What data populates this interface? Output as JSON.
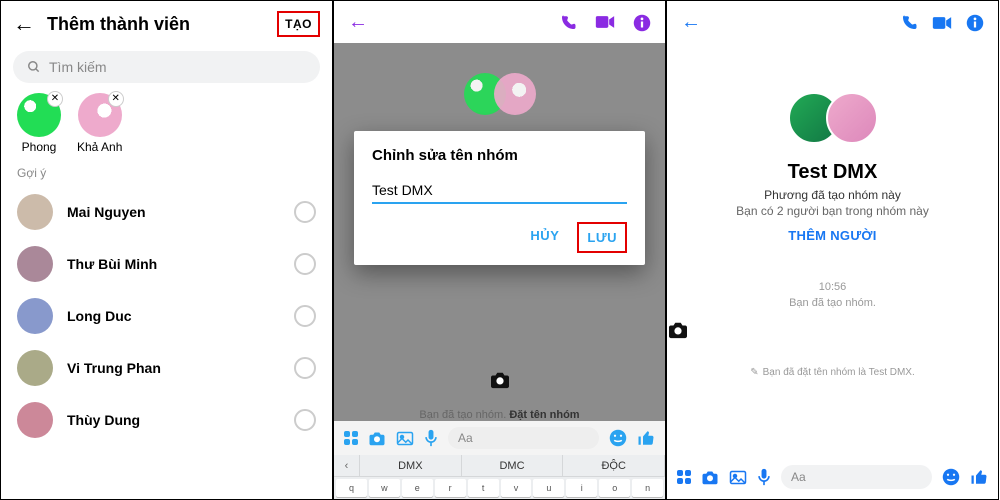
{
  "panel1": {
    "title": "Thêm thành viên",
    "create": "TẠO",
    "search_placeholder": "Tìm kiếm",
    "selected": [
      {
        "name": "Phong"
      },
      {
        "name": "Khả Anh"
      }
    ],
    "suggestion_label": "Gợi ý",
    "suggestions": [
      {
        "name": "Mai Nguyen"
      },
      {
        "name": "Thư Bùi Minh"
      },
      {
        "name": "Long Duc"
      },
      {
        "name": "Vi Trung Phan"
      },
      {
        "name": "Thùy Dung"
      }
    ]
  },
  "panel2": {
    "dialog_title": "Chỉnh sửa tên nhóm",
    "input_value": "Test DMX",
    "cancel": "HỦY",
    "save": "LƯU",
    "composer_placeholder": "Aa",
    "under_prefix": "Bạn đã tạo nhóm.",
    "under_link": "Đặt tên nhóm",
    "kbd_suggestions": [
      "DMX",
      "DMC",
      "ĐỘC"
    ]
  },
  "panel3": {
    "group_name": "Test DMX",
    "creator_line": "Phương đã tạo nhóm này",
    "friends_line": "Bạn có 2 người bạn trong nhóm này",
    "add_people": "THÊM NGƯỜI",
    "time": "10:56",
    "created_msg": "Bạn đã tạo nhóm.",
    "named_line": "Bạn đã đặt tên nhóm là Test DMX.",
    "composer_placeholder": "Aa"
  }
}
